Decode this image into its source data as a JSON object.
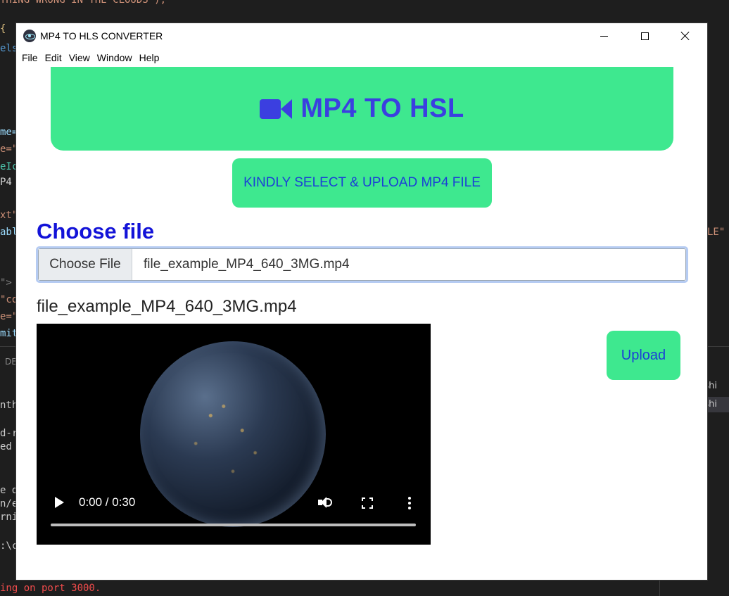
{
  "background_editor": {
    "lines": [
      {
        "text": "THING WRONG IN THE CLOUDS\");",
        "color": "#ce9178"
      },
      {
        "text": "{",
        "color": "#d7ba7d"
      },
      {
        "text": "else",
        "color": "#569cd6"
      },
      {
        "text": "me=",
        "color": "#9cdcfe"
      },
      {
        "text": "e=\"",
        "color": "#ce9178"
      },
      {
        "text": "eIc",
        "color": "#4ec9b0"
      },
      {
        "text": "P4",
        "color": "#d4d4d4"
      },
      {
        "text": "xt\"",
        "color": "#ce9178"
      },
      {
        "text": "abl",
        "color": "#9cdcfe"
      },
      {
        "text": "\">",
        "color": "#808080"
      },
      {
        "text": "\"co",
        "color": "#ce9178"
      },
      {
        "text": "e=\"",
        "color": "#ce9178"
      },
      {
        "text": "mit",
        "color": "#9cdcfe"
      },
      {
        "text": "DE",
        "color": "#8a8a8a"
      },
      {
        "text": "ntho",
        "color": "#cccccc"
      },
      {
        "text": "d-re",
        "color": "#cccccc"
      },
      {
        "text": "ed -",
        "color": "#cccccc"
      },
      {
        "text": "e de",
        "color": "#cccccc"
      },
      {
        "text": "n/el",
        "color": "#cccccc"
      },
      {
        "text": "rnin",
        "color": "#cccccc"
      },
      {
        "text": ":\\c",
        "color": "#cccccc"
      },
      {
        "text": "ing on port 3000.",
        "color": "#f14c4c"
      },
      {
        "text": "LE\"",
        "color": "#ce9178"
      }
    ],
    "right_panel_items": [
      "ershi",
      "ershi"
    ]
  },
  "window": {
    "title": "MP4 TO HLS CONVERTER",
    "menu": [
      "File",
      "Edit",
      "View",
      "Window",
      "Help"
    ],
    "controls": {
      "minimize": "minimize",
      "maximize": "maximize",
      "close": "close"
    }
  },
  "hero": {
    "icon": "video-camera-icon",
    "title": "MP4 TO HSL",
    "color": "#3ee88f",
    "text_color": "#3b3fe0"
  },
  "select_button": {
    "label": "KINDLY SELECT & UPLOAD MP4 FILE"
  },
  "choose_file": {
    "heading": "Choose file",
    "button_label": "Choose File",
    "selected_file": "file_example_MP4_640_3MG.mp4"
  },
  "preview": {
    "caption": "file_example_MP4_640_3MG.mp4",
    "player": {
      "current_time": "0:00",
      "duration": "0:30",
      "time_text": "0:00 / 0:30",
      "progress": 0
    }
  },
  "upload_button": {
    "label": "Upload"
  }
}
